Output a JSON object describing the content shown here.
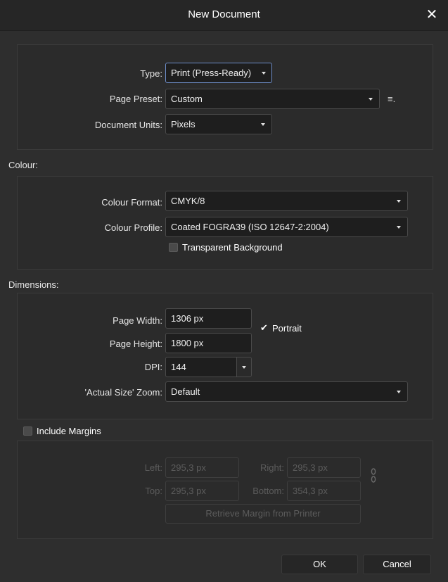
{
  "window": {
    "title": "New Document",
    "close_glyph": "✕"
  },
  "document": {
    "type_label": "Type:",
    "type_value": "Print (Press-Ready)",
    "preset_label": "Page Preset:",
    "preset_value": "Custom",
    "preset_menu_icon": "≡.",
    "units_label": "Document Units:",
    "units_value": "Pixels"
  },
  "colour": {
    "section": "Colour:",
    "format_label": "Colour Format:",
    "format_value": "CMYK/8",
    "profile_label": "Colour Profile:",
    "profile_value": "Coated FOGRA39 (ISO 12647-2:2004)",
    "transparent_label": "Transparent Background",
    "transparent_checked": false
  },
  "dimensions": {
    "section": "Dimensions:",
    "width_label": "Page Width:",
    "width_value": "1306 px",
    "height_label": "Page Height:",
    "height_value": "1800 px",
    "portrait_label": "Portrait",
    "portrait_checked": true,
    "portrait_glyph": "✔",
    "dpi_label": "DPI:",
    "dpi_value": "144",
    "zoom_label": "'Actual Size' Zoom:",
    "zoom_value": "Default"
  },
  "margins": {
    "include_label": "Include Margins",
    "include_checked": false,
    "left_label": "Left:",
    "left_value": "295,3 px",
    "right_label": "Right:",
    "right_value": "295,3 px",
    "top_label": "Top:",
    "top_value": "295,3 px",
    "bottom_label": "Bottom:",
    "bottom_value": "354,3 px",
    "retrieve_label": "Retrieve Margin from Printer"
  },
  "footer": {
    "ok_label": "OK",
    "cancel_label": "Cancel"
  },
  "colors": {
    "accent_focus": "#6d8dc8",
    "background": "#2e2e2e",
    "titlebar": "#262626"
  },
  "icons": {
    "close": "close-icon",
    "dropdown": "chevron-down-icon",
    "link": "chain-link-icon",
    "menu": "preset-menu-icon"
  }
}
